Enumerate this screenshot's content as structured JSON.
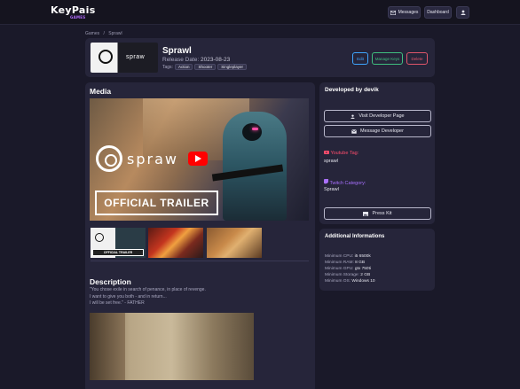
{
  "brand": {
    "logo_text": "KeyPais",
    "logo_sub": "GAMES"
  },
  "topnav": {
    "messages_label": "Messages",
    "dashboard_label": "Dashboard"
  },
  "breadcrumb": {
    "home": "Games",
    "separator": "/",
    "current": "Sprawl"
  },
  "game": {
    "title": "Sprawl",
    "release_label": "Release Date:",
    "release_date": "2023-08-23",
    "tags_label": "Tags:",
    "tags": [
      "Action",
      "Shooter",
      "Singleplayer"
    ],
    "thumb_word": "spraw"
  },
  "actions": {
    "edit": "Edit",
    "manage_keys": "Manage Keys",
    "delete": "Delete"
  },
  "media": {
    "title": "Media",
    "trailer_word": "spraw",
    "trailer_caption": "OFFICIAL TRAILER",
    "thumb_caption": "OFFICIAL TRAILER"
  },
  "description": {
    "title": "Description",
    "lines": [
      "\"You chose exile in search of penance, in place of revenge.",
      "I want to give you both - and in return...",
      "I will be set free.\" - FATHER"
    ]
  },
  "developer": {
    "title": "Developed by devik",
    "visit_label": "Visit Developer Page",
    "message_label": "Message Developer",
    "youtube_label": "Youtube Tag:",
    "youtube_value": "sprawl",
    "twitch_label": "Twitch Category:",
    "twitch_value": "Sprawl",
    "presskit_label": "Press Kit"
  },
  "additional": {
    "title": "Additional Informations",
    "rows": [
      {
        "label": "Minimum CPU:",
        "value": "i5 6500k"
      },
      {
        "label": "Minimum RAM:",
        "value": "8 GB"
      },
      {
        "label": "Minimum GPU:",
        "value": "gtx 750ti"
      },
      {
        "label": "Minimum Storage:",
        "value": "2 GB"
      },
      {
        "label": "Minimum OS:",
        "value": "Windows 10"
      }
    ]
  },
  "colors": {
    "edit": "#3ea6ff",
    "manage_keys": "#3fbf7f",
    "delete": "#e0566a",
    "youtube": "#ff4d6d",
    "twitch": "#a970ff"
  }
}
